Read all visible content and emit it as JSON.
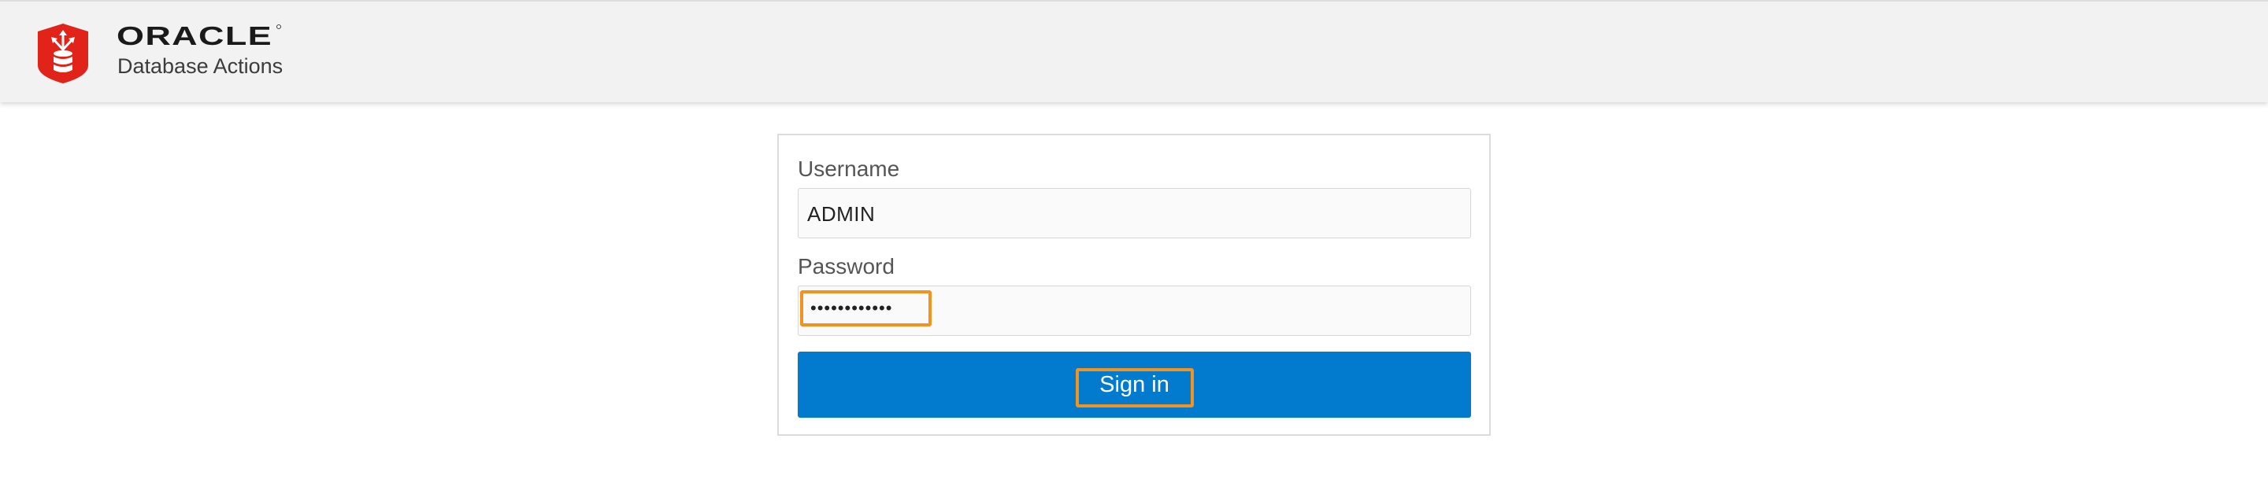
{
  "header": {
    "brand_name": "ORACLE",
    "product_name": "Database Actions",
    "logo_icon": "oracle-database-icon",
    "brand_color": "#e2231a"
  },
  "login_form": {
    "username_label": "Username",
    "username_value": "ADMIN",
    "password_label": "Password",
    "password_value": "••••••••••••",
    "signin_label": "Sign in",
    "button_color": "#027bce",
    "highlight_color": "#f0931f"
  }
}
